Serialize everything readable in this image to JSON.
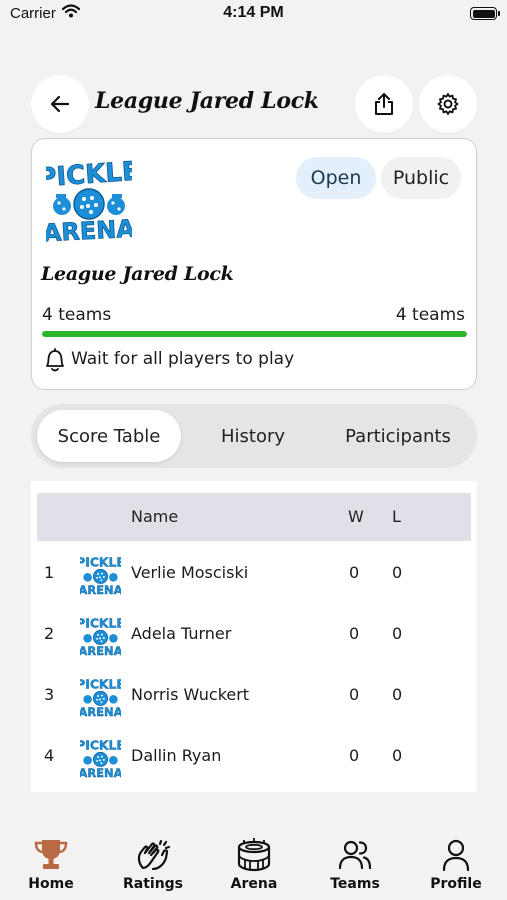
{
  "status_bar": {
    "carrier": "Carrier",
    "time": "4:14 PM"
  },
  "header": {
    "title": "League Jared Lock"
  },
  "league": {
    "logo_text_top": "PICKLE",
    "logo_text_bottom": "ARENA",
    "status": "Open",
    "visibility": "Public",
    "name": "League Jared Lock",
    "teams_joined": "4 teams",
    "teams_total": "4 teams",
    "progress_fraction": 1.0,
    "progress_color": "#2ab52a",
    "message": "Wait for all players to play"
  },
  "tabs": [
    {
      "label": "Score Table",
      "active": true
    },
    {
      "label": "History",
      "active": false
    },
    {
      "label": "Participants",
      "active": false
    }
  ],
  "score_table": {
    "headers": {
      "name": "Name",
      "wins": "W",
      "losses": "L"
    },
    "rows": [
      {
        "rank": "1",
        "name": "Verlie Mosciski",
        "wins": "0",
        "losses": "0"
      },
      {
        "rank": "2",
        "name": "Adela Turner",
        "wins": "0",
        "losses": "0"
      },
      {
        "rank": "3",
        "name": "Norris Wuckert",
        "wins": "0",
        "losses": "0"
      },
      {
        "rank": "4",
        "name": "Dallin Ryan",
        "wins": "0",
        "losses": "0"
      }
    ]
  },
  "tab_bar": {
    "items": [
      {
        "label": "Home",
        "icon": "trophy-icon",
        "active": true
      },
      {
        "label": "Ratings",
        "icon": "clapping-hands-icon",
        "active": false
      },
      {
        "label": "Arena",
        "icon": "stadium-icon",
        "active": false
      },
      {
        "label": "Teams",
        "icon": "users-icon",
        "active": false
      },
      {
        "label": "Profile",
        "icon": "person-icon",
        "active": false
      }
    ]
  },
  "colors": {
    "accent_blue": "#1d8fd8",
    "home_active": "#b86a45",
    "pill_open_bg": "#e3f0fb"
  }
}
